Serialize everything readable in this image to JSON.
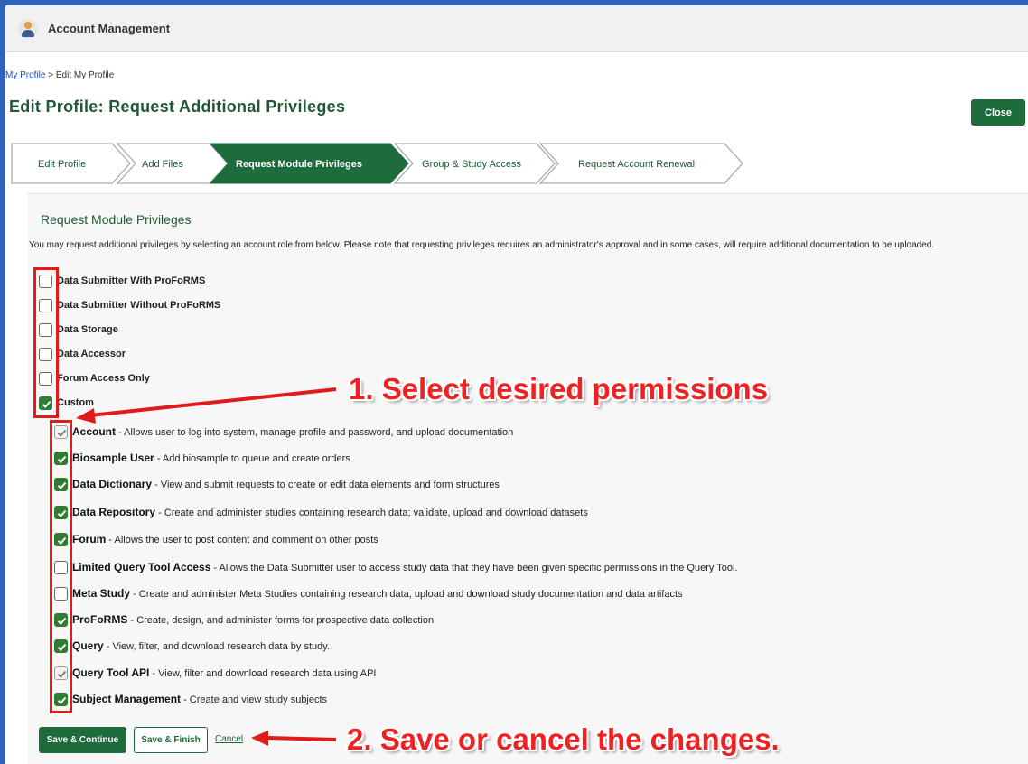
{
  "app": {
    "title": "Account Management"
  },
  "breadcrumb": {
    "link": "My Profile",
    "separator": " > ",
    "current": "Edit My Profile"
  },
  "page": {
    "title": "Edit Profile: Request Additional Privileges",
    "close_label": "Close"
  },
  "wizard": {
    "steps": [
      {
        "label": "Edit Profile",
        "active": false
      },
      {
        "label": "Add Files",
        "active": false
      },
      {
        "label": "Request Module Privileges",
        "active": true
      },
      {
        "label": "Group & Study Access",
        "active": false
      },
      {
        "label": "Request Account Renewal",
        "active": false
      }
    ]
  },
  "section": {
    "title": "Request Module Privileges",
    "intro": "You may request additional privileges by selecting an account role from below. Please note that requesting privileges requires an administrator's approval and in some cases, will require additional documentation to be uploaded."
  },
  "roles": [
    {
      "label": "Data Submitter With ProFoRMS",
      "state": "unchecked"
    },
    {
      "label": "Data Submitter Without ProFoRMS",
      "state": "unchecked"
    },
    {
      "label": "Data Storage",
      "state": "unchecked"
    },
    {
      "label": "Data Accessor",
      "state": "unchecked"
    },
    {
      "label": "Forum Access Only",
      "state": "unchecked"
    },
    {
      "label": "Custom",
      "state": "checked"
    }
  ],
  "permissions": [
    {
      "name": "Account",
      "desc": " - Allows user to log into system, manage profile and password, and upload documentation",
      "state": "disabled-checked"
    },
    {
      "name": "Biosample User",
      "desc": " - Add biosample to queue and create orders",
      "state": "checked"
    },
    {
      "name": "Data Dictionary",
      "desc": " - View and submit requests to create or edit data elements and form structures",
      "state": "checked"
    },
    {
      "name": "Data Repository",
      "desc": " - Create and administer studies containing research data; validate, upload and download datasets",
      "state": "checked"
    },
    {
      "name": "Forum",
      "desc": " - Allows the user to post content and comment on other posts",
      "state": "checked"
    },
    {
      "name": "Limited Query Tool Access",
      "desc": " - Allows the Data Submitter user to access study data that they have been given specific permissions in the Query Tool.",
      "state": "unchecked"
    },
    {
      "name": "Meta Study",
      "desc": " - Create and administer Meta Studies containing research data, upload and download study documentation and data artifacts",
      "state": "unchecked"
    },
    {
      "name": "ProFoRMS",
      "desc": " - Create, design, and administer forms for prospective data collection",
      "state": "checked"
    },
    {
      "name": "Query",
      "desc": " - View, filter, and download research data by study.",
      "state": "checked"
    },
    {
      "name": "Query Tool API",
      "desc": " - View, filter and download research data using API",
      "state": "disabled-checked"
    },
    {
      "name": "Subject Management",
      "desc": " - Create and view study subjects",
      "state": "checked"
    }
  ],
  "actions": {
    "save_continue": "Save & Continue",
    "save_finish": "Save & Finish",
    "cancel": "Cancel"
  },
  "annotations": {
    "step1": "1. Select desired permissions",
    "step2": "2. Save or cancel the changes."
  },
  "colors": {
    "brand_green": "#1e6b3c",
    "checkbox_green": "#2e7d32",
    "annotation_red": "#e01b1b",
    "frame_blue": "#2f63b7"
  },
  "icons": {
    "app": "user-avatar-icon",
    "check": "checkmark-icon",
    "arrow": "red-arrow-icon"
  }
}
